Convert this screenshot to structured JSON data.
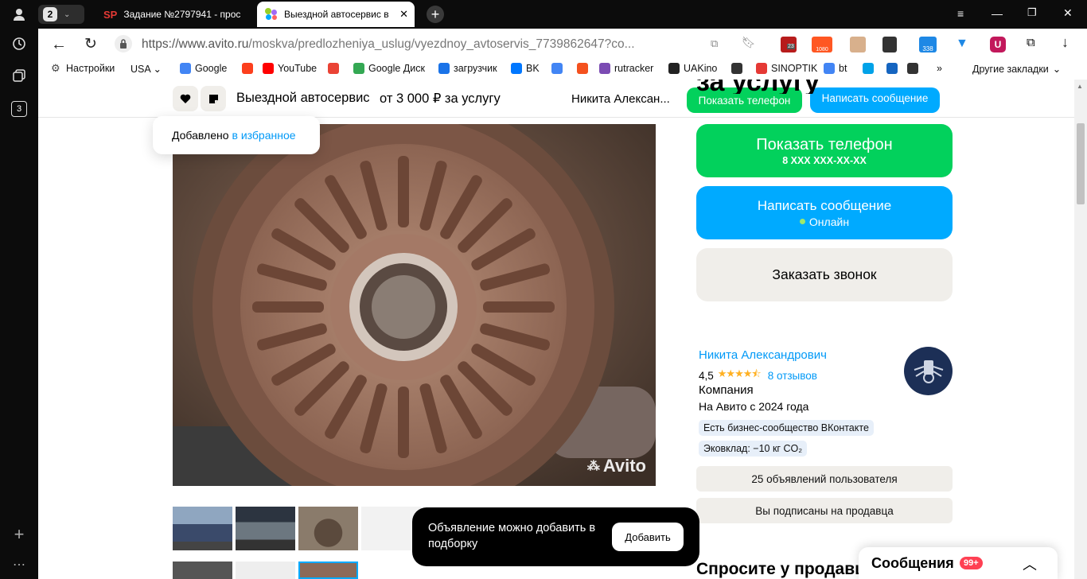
{
  "browser": {
    "tab_count": "2",
    "tabs": [
      {
        "favicon_text": "SP",
        "title": "Задание №2797941 - прос"
      },
      {
        "title": "Выездной автосервис в"
      }
    ],
    "url": "https://www.avito.ru/moskva/predlozheniya_uslug/vyezdnoy_avtoservis_7739862647?co...",
    "url_host": "https://www.avito.ru",
    "url_path": "/moskva/predlozheniya_uslug/vyezdnoy_avtoservis_7739862647?co...",
    "sidebar_badge": "3",
    "ext_badges": {
      "a": "23",
      "b": "1080",
      "c": "338"
    }
  },
  "bookmarks": {
    "items": [
      {
        "label": "Настройки",
        "icon": "gear-icon",
        "color": "#444"
      },
      {
        "label": "USA",
        "icon": "",
        "color": ""
      },
      {
        "label": "Google",
        "icon": "google-icon",
        "color": "#4285f4"
      },
      {
        "label": "",
        "icon": "yandex-icon",
        "color": "#fc3f1d"
      },
      {
        "label": "YouTube",
        "icon": "youtube-icon",
        "color": "#ff0000"
      },
      {
        "label": "",
        "icon": "gmail-icon",
        "color": "#ea4335"
      },
      {
        "label": "Google Диск",
        "icon": "drive-icon",
        "color": "#34a853"
      },
      {
        "label": "загрузчик",
        "icon": "loader-icon",
        "color": "#1a73e8"
      },
      {
        "label": "BK",
        "icon": "vk-icon",
        "color": "#0077ff"
      },
      {
        "label": "",
        "icon": "translate-icon",
        "color": "#4285f4"
      },
      {
        "label": "",
        "icon": "f-icon",
        "color": "#f4511e"
      },
      {
        "label": "rutracker",
        "icon": "rutracker-icon",
        "color": "#7b4bb3"
      },
      {
        "label": "UAKino",
        "icon": "uakino-icon",
        "color": "#222"
      },
      {
        "label": "",
        "icon": "s-icon",
        "color": "#333"
      },
      {
        "label": "SINOPTIK",
        "icon": "thermometer-icon",
        "color": "#e53935"
      },
      {
        "label": "bt",
        "icon": "google-icon",
        "color": "#4285f4"
      },
      {
        "label": "",
        "icon": "p-icon",
        "color": "#00a2e8"
      },
      {
        "label": "",
        "icon": "chevron-left-icon",
        "color": "#1565c0"
      },
      {
        "label": "",
        "icon": "bc-icon",
        "color": "#333"
      }
    ],
    "more": "»",
    "other": "Другие закладки"
  },
  "sticky": {
    "title": "Выездной автосервис",
    "price": "от 3 000 ₽ за услугу",
    "seller": "Никита Алексан...",
    "phone_btn": "Показать телефон",
    "message_btn": "Написать сообщение",
    "heading_fragment": "за услугу"
  },
  "toast": {
    "text": "Добавлено",
    "link": "в избранное"
  },
  "photo": {
    "watermark": "Avito"
  },
  "contact": {
    "phone_label": "Показать телефон",
    "phone_masked": "8 XXX XXX-XX-XX",
    "message_label": "Написать сообщение",
    "online": "Онлайн",
    "call_label": "Заказать звонок"
  },
  "seller": {
    "name": "Никита Александрович",
    "rating": "4,5",
    "stars": 4.5,
    "reviews": "8 отзывов",
    "type": "Компания",
    "since": "На Авито с 2024 года",
    "tags": [
      "Есть бизнес-сообщество ВКонтакте",
      "Эковклад: −10 кг CO₂"
    ],
    "listings_btn": "25 объявлений пользователя",
    "subscribed_btn": "Вы подписаны на продавца"
  },
  "popup": {
    "text": "Объявление можно добавить в подборку",
    "button": "Добавить"
  },
  "ask": {
    "heading": "Спросите у продавца"
  },
  "messages": {
    "label": "Сообщения",
    "badge": "99+"
  },
  "colors": {
    "green": "#02d15c",
    "blue": "#00aaff",
    "link": "#0099f7",
    "star": "#ffb021"
  }
}
